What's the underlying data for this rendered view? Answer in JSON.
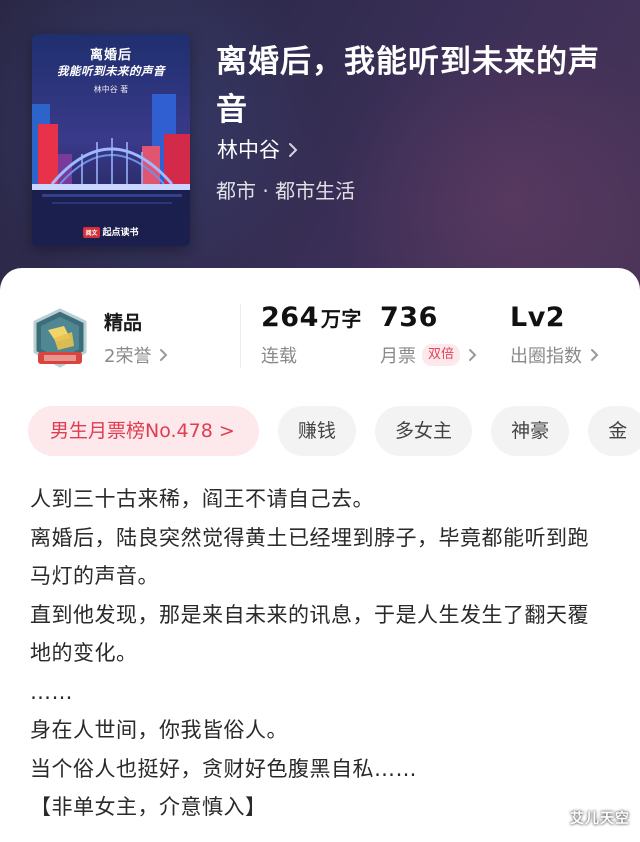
{
  "book": {
    "title": "离婚后，我能听到未来的声音",
    "author": "林中谷",
    "genre": "都市 · 都市生活",
    "cover": {
      "title": "离婚后",
      "subtitle": "我能听到未来的声音",
      "author": "林中谷 著",
      "publisher": "起点读书",
      "publisher_badge": "阅文"
    }
  },
  "stats": {
    "quality_label": "精品",
    "honors": "2荣誉",
    "word_count": "264",
    "word_unit": "万字",
    "status": "连载",
    "monthly_votes": "736",
    "monthly_votes_label": "月票",
    "double_badge": "双倍",
    "level": "Lv2",
    "level_label": "出圈指数"
  },
  "tags": [
    "男生月票榜No.478 >",
    "赚钱",
    "多女主",
    "神豪",
    "金"
  ],
  "description": [
    "人到三十古来稀，阎王不请自己去。",
    "离婚后，陆良突然觉得黄土已经埋到脖子，毕竟都能听到跑马灯的声音。",
    "直到他发现，那是来自未来的讯息，于是人生发生了翻天覆地的变化。",
    "……",
    "身在人世间，你我皆俗人。",
    "当个俗人也挺好，贪财好色腹黑自私……",
    "【非单女主，介意慎入】"
  ],
  "watermark": "艾儿天空",
  "colors": {
    "header_bg": "#2f2b4e",
    "accent_red": "#e03c52",
    "rank_tag_bg": "#fde8eb",
    "tag_bg": "#f3f3f3"
  }
}
